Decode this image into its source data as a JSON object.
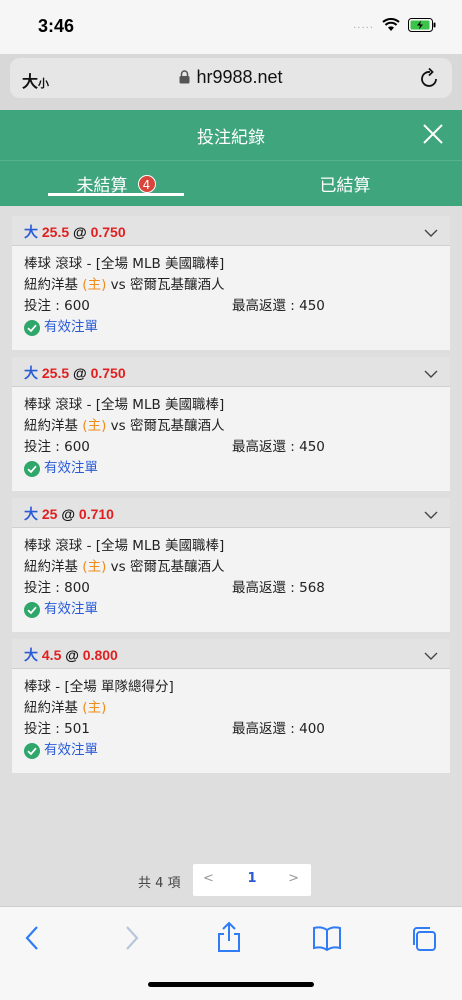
{
  "status_bar": {
    "time": "3:46",
    "signal": "....."
  },
  "browser": {
    "text_size_label_big": "大",
    "text_size_label_small": "小",
    "url": "hr9988.net"
  },
  "modal": {
    "title": "投注紀錄"
  },
  "tabs": {
    "unsettled": "未結算",
    "unsettled_badge": "4",
    "settled": "已結算"
  },
  "bets": [
    {
      "side": "大",
      "line": "25.5",
      "at": "@",
      "odds": "0.750",
      "league": "棒球 滾球 - [全場 MLB 美國職棒]",
      "team_home": "紐約洋基",
      "home_tag": "(主)",
      "vs": "vs",
      "team_away": "密爾瓦基釀酒人",
      "stake": "投注 : 600",
      "max_return": "最高返還 : 450",
      "status": "有效注單"
    },
    {
      "side": "大",
      "line": "25.5",
      "at": "@",
      "odds": "0.750",
      "league": "棒球 滾球 - [全場 MLB 美國職棒]",
      "team_home": "紐約洋基",
      "home_tag": "(主)",
      "vs": "vs",
      "team_away": "密爾瓦基釀酒人",
      "stake": "投注 : 600",
      "max_return": "最高返還 : 450",
      "status": "有效注單"
    },
    {
      "side": "大",
      "line": "25",
      "at": "@",
      "odds": "0.710",
      "league": "棒球 滾球 - [全場 MLB 美國職棒]",
      "team_home": "紐約洋基",
      "home_tag": "(主)",
      "vs": "vs",
      "team_away": "密爾瓦基釀酒人",
      "stake": "投注 : 800",
      "max_return": "最高返還 : 568",
      "status": "有效注單"
    },
    {
      "side": "大",
      "line": "4.5",
      "at": "@",
      "odds": "0.800",
      "league": "棒球 - [全場 單隊總得分]",
      "team_home": "紐約洋基",
      "home_tag": "(主)",
      "vs": "",
      "team_away": "",
      "stake": "投注 : 501",
      "max_return": "最高返還 : 400",
      "status": "有效注單"
    }
  ],
  "pagination": {
    "total": "共 4 項",
    "prev": "<",
    "page": "1",
    "next": ">"
  },
  "colors": {
    "header_green": "#3fa57d",
    "badge_red": "#d9443b",
    "link_blue": "#2a5bd7",
    "odds_red": "#e02020",
    "home_orange": "#f08c1a"
  }
}
